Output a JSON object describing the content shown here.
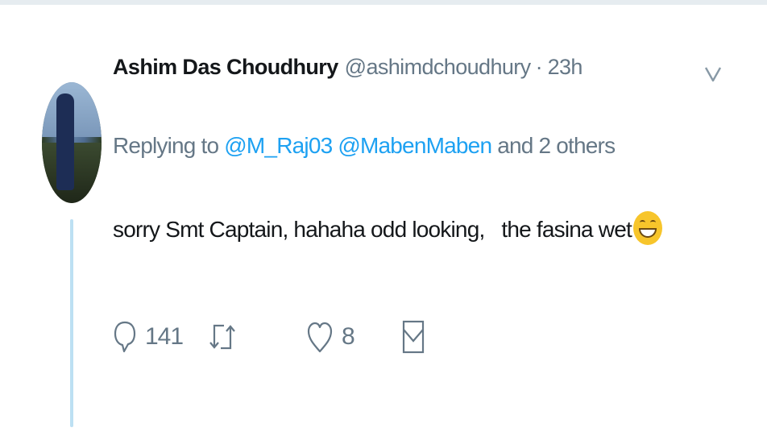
{
  "tweet": {
    "author_name": "Ashim Das Choudhury",
    "author_handle": "@ashimdchoudhury",
    "separator": "·",
    "timestamp": "23h",
    "reply_prefix": "Replying to",
    "reply_mentions": [
      "@M_Raj03",
      "@MabenMaben"
    ],
    "reply_suffix": "and 2 others",
    "text": "sorry Smt Captain, hahaha odd looking,   the fasina wet",
    "emoji": "grinning-squinting-face",
    "actions": {
      "reply_count": "141",
      "retweet_count": "",
      "like_count": "8"
    }
  },
  "colors": {
    "link": "#1da1f2",
    "secondary_text": "#657786",
    "thread_line": "#bde0f3"
  }
}
